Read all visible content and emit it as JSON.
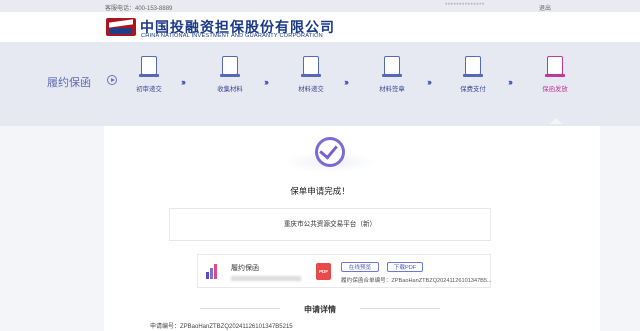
{
  "topbar": {
    "hotline": "客服电话：400-153-8889",
    "user_masked": "**************",
    "logout": "退出"
  },
  "brand": {
    "name_cn": "中国投融资担保股份有限公司",
    "name_en": "CHINA NATIONAL INVESTMENT AND GUARANTY CORPORATION"
  },
  "process": {
    "title": "履约保函",
    "steps": [
      {
        "label": "初审递交",
        "icon": "seal-document-icon",
        "active": false
      },
      {
        "label": "收集材料",
        "icon": "edit-document-icon",
        "active": false
      },
      {
        "label": "材料递交",
        "icon": "submit-document-icon",
        "active": false
      },
      {
        "label": "材料签章",
        "icon": "stamp-icon",
        "active": false
      },
      {
        "label": "保费支付",
        "icon": "payment-icon",
        "active": false
      },
      {
        "label": "保函发放",
        "icon": "issue-document-icon",
        "active": true
      }
    ],
    "accent": "#c0399a"
  },
  "result": {
    "message": "保单申请完成！",
    "platform": "重庆市公共资源交易平台（新）"
  },
  "product": {
    "name": "履约保函",
    "preview_label": "在线预览",
    "download_label": "下载PDF",
    "guarantee_no": "履约保函合单编号：ZPBaoHanZTBZQ20241126101347B5..."
  },
  "details": {
    "title": "申请详情",
    "apply_no": "申请编号：ZPBaoHanZTBZQ20241126101347B5215"
  }
}
